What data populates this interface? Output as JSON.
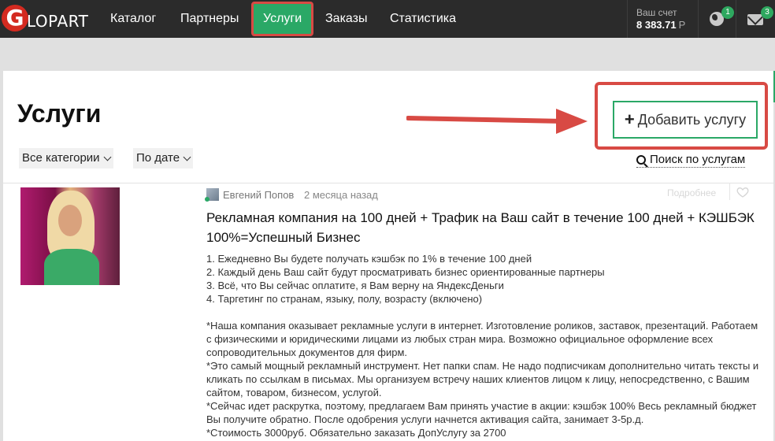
{
  "brand": {
    "logo_letter": "G",
    "logo_text": "LOPART"
  },
  "nav": [
    {
      "label": "Каталог"
    },
    {
      "label": "Партнеры"
    },
    {
      "label": "Услуги",
      "active": true
    },
    {
      "label": "Заказы"
    },
    {
      "label": "Статистика"
    }
  ],
  "account": {
    "label": "Ваш счет",
    "value": "8 383.71",
    "currency": "Р"
  },
  "notifications": {
    "globe_count": "1",
    "mail_count": "3",
    "icons": [
      "globe-icon",
      "envelope-icon"
    ]
  },
  "page": {
    "title": "Услуги",
    "add_button": "Добавить услугу",
    "add_button_icon": "plus-icon",
    "filters": [
      "Все категории",
      "По дате"
    ],
    "search_link": "Поиск по услугам"
  },
  "listing": {
    "author": "Евгений Попов",
    "time": "2 месяца назад",
    "more_link": "Подробнее",
    "title": "Рекламная компания на 100 дней + Трафик на Ваш сайт в течение 100 дней + КЭШБЭК 100%=Успешный Бизнес",
    "description": [
      "1. Ежедневно Вы будете получать кэшбэк по 1% в течение 100 дней",
      "2. Каждый день Ваш сайт будут просматривать бизнес ориентированные партнеры",
      "3. Всё, что Вы сейчас оплатите, я Вам верну на ЯндексДеньги",
      "4. Таргетинг по странам, языку, полу, возрасту (включено)",
      "",
      "*Наша компания оказывает рекламные услуги в интернет. Изготовление роликов, заставок, презентаций. Работаем с физическими и юридическими лицами из любых стран мира. Возможно официальное оформление всех сопроводительных документов для фирм.",
      "*Это самый мощный рекламный инструмент. Нет папки спам. Не надо подписчикам дополнительно читать тексты и кликать по ссылкам в письмах. Мы организуем встречу наших клиентов лицом к лицу, непосредственно, с Вашим сайтом, товаром, бизнесом, услугой.",
      "*Сейчас идет раскрутка, поэтому, предлагаем Вам принять участие в акции: кэшбэк 100% Весь рекламный бюджет Вы получите обратно. После одобрения услуги начнется активация сайта, занимает 3-5р.д.",
      "*Стоимость 3000руб. Обязательно заказать ДопУслугу за 2700"
    ]
  },
  "colors": {
    "topbar": "#2b2b2b",
    "accent": "#2aa866",
    "highlight": "#d84a44"
  }
}
